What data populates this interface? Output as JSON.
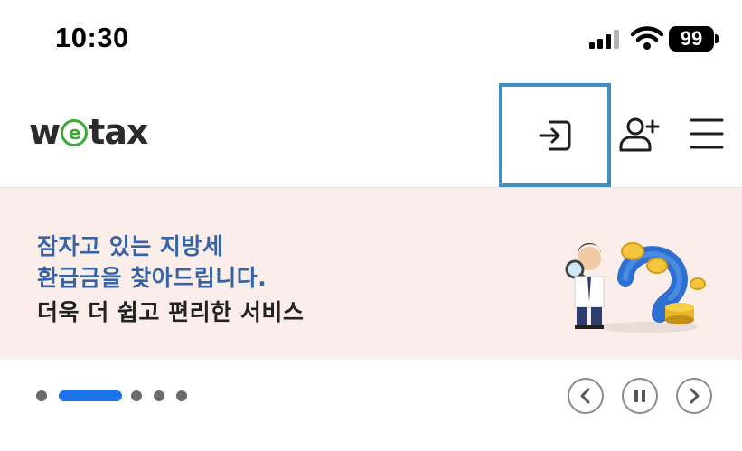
{
  "status_bar": {
    "time": "10:30",
    "battery": "99",
    "icons": [
      "cellular-signal-icon",
      "wifi-icon",
      "battery-icon"
    ]
  },
  "header": {
    "logo": {
      "text_before": "w",
      "text_e": "e",
      "text_after": "tax",
      "accent_color": "#3aaa35"
    },
    "login_icon": "login-icon",
    "signup_icon": "person-add-icon",
    "menu_icon": "hamburger-menu-icon",
    "highlight_color": "#3f8fbf"
  },
  "banner": {
    "line1": "잠자고 있는 지방세",
    "line2": "환급금을 찾아드립니다.",
    "line3": "더욱 더 쉽고 편리한 서비스",
    "background": "#fbeeea",
    "accent_color": "#3563a6"
  },
  "carousel": {
    "slide_count": 5,
    "active_index": 1,
    "active_color": "#1a73e8",
    "prev_icon": "chevron-left-icon",
    "pause_icon": "pause-icon",
    "next_icon": "chevron-right-icon"
  }
}
